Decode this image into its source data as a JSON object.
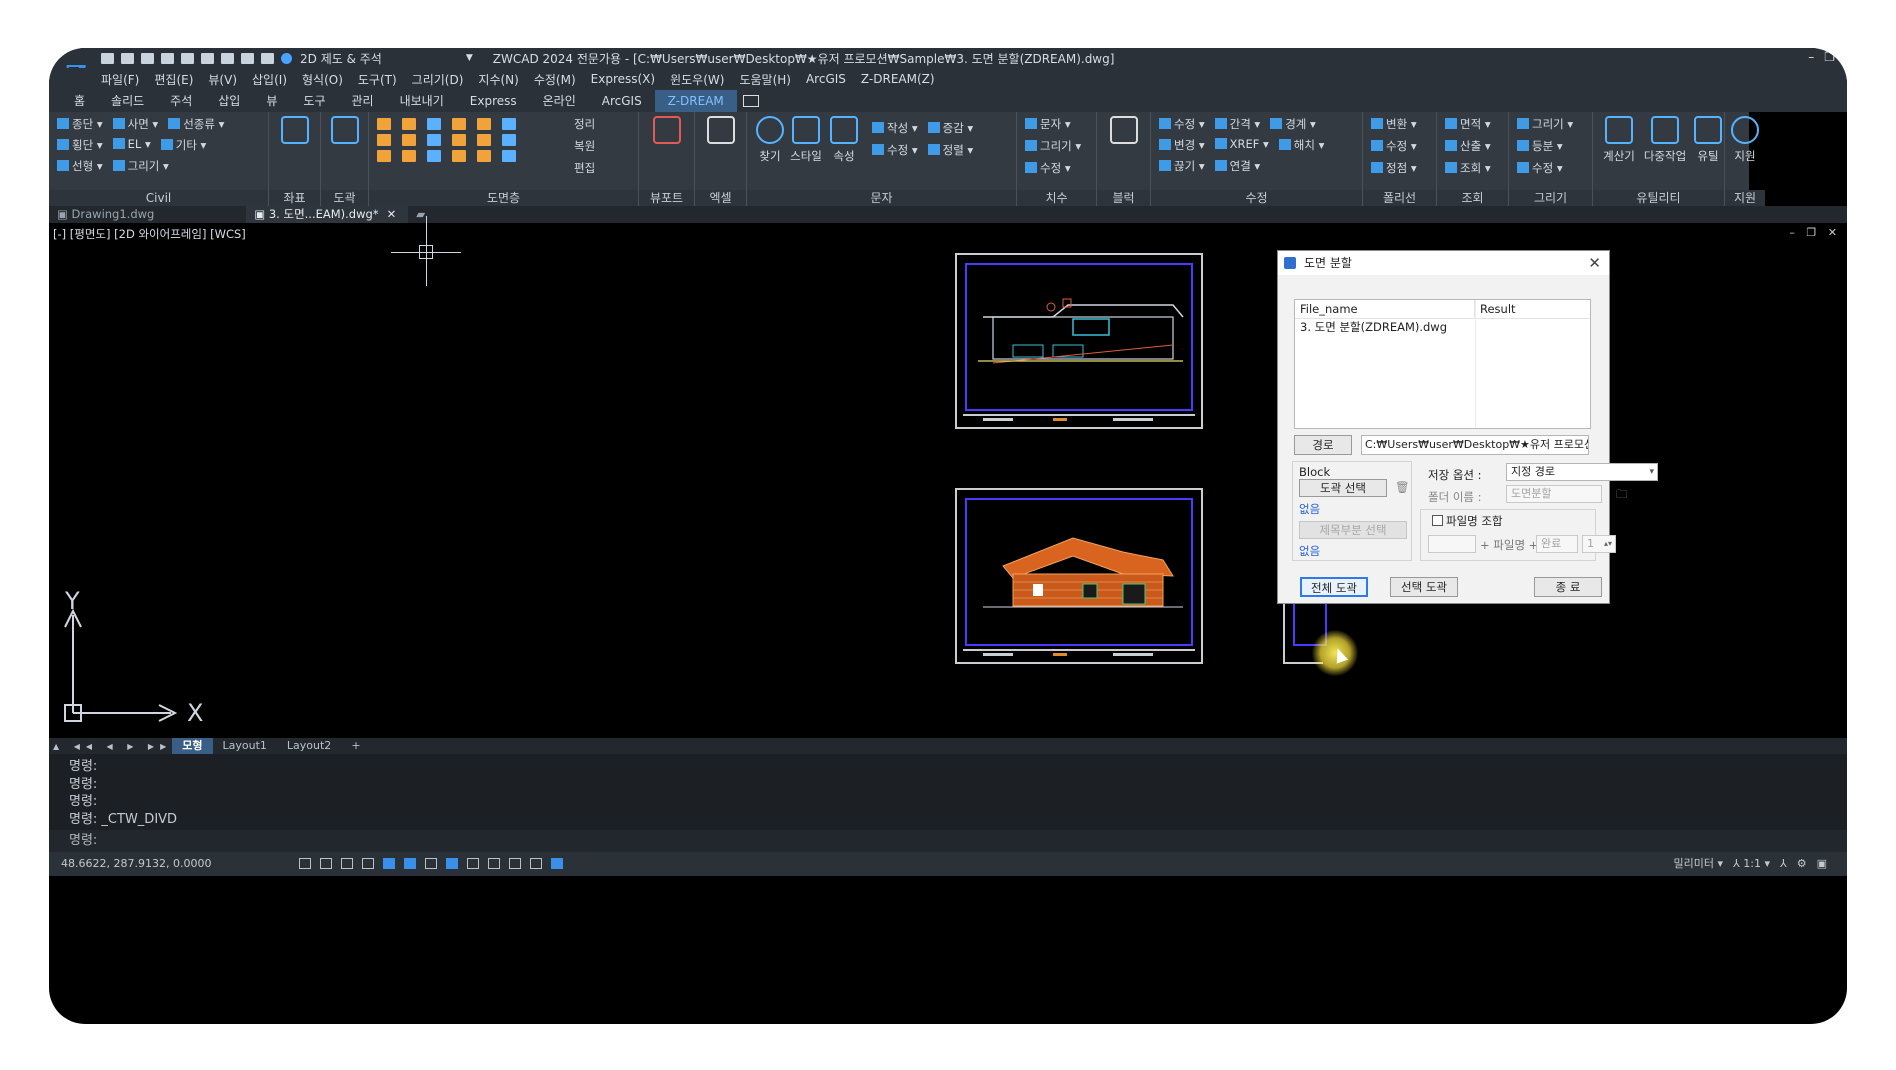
{
  "title_bar": {
    "workspace": "2D 제도 & 주석",
    "title": "ZWCAD 2024 전문가용 - [C:₩Users₩user₩Desktop₩★유저 프로모션₩Sample₩3. 도면 분할(ZDREAM).dwg]"
  },
  "menu": [
    "파일(F)",
    "편집(E)",
    "뷰(V)",
    "삽입(I)",
    "형식(O)",
    "도구(T)",
    "그리기(D)",
    "지수(N)",
    "수정(M)",
    "Express(X)",
    "윈도우(W)",
    "도움말(H)",
    "ArcGIS",
    "Z-DREAM(Z)"
  ],
  "ribbon_tabs": [
    "홈",
    "솔리드",
    "주석",
    "삽입",
    "뷰",
    "도구",
    "관리",
    "내보내기",
    "Express",
    "온라인",
    "ArcGIS",
    "Z-DREAM"
  ],
  "active_tab": "Z-DREAM",
  "ribbon": {
    "civil": {
      "caption": "Civil",
      "row1": [
        "종단",
        "사면",
        "선종류"
      ],
      "row2": [
        "횡단",
        "EL",
        "기타"
      ],
      "row3": [
        "선형",
        "그리기"
      ]
    },
    "coord": {
      "caption": "좌표"
    },
    "drawing": {
      "caption": "도곽"
    },
    "layers": {
      "caption": "도면층",
      "row1": "정리",
      "row2": "복원",
      "row3": "편집"
    },
    "viewport": {
      "caption": "뷰포트"
    },
    "excel": {
      "caption": "엑셀"
    },
    "text": {
      "caption": "문자",
      "find": "찾기",
      "style": "스타일",
      "prop": "속성",
      "row1": [
        "작성",
        "증감"
      ],
      "row2": [
        "수정",
        "정렬"
      ]
    },
    "dim": {
      "caption": "치수",
      "row1": "문자",
      "row2": "그리기",
      "row3": "수정"
    },
    "block": {
      "caption": "블럭"
    },
    "modify": {
      "caption": "수정",
      "row1": [
        "수정",
        "간격",
        "경계"
      ],
      "row2": [
        "변경",
        "XREF",
        "해치"
      ],
      "row3": [
        "끊기",
        "연결"
      ]
    },
    "polyline": {
      "caption": "폴리선",
      "row1": "변환",
      "row2": "수정",
      "row3": "정점"
    },
    "query": {
      "caption": "조회",
      "row1": "면적",
      "row2": "산출",
      "row3": "조회"
    },
    "drawing2": {
      "caption": "그리기",
      "row1": "그리기",
      "row2": "등분",
      "row3": "수정"
    },
    "utility": {
      "caption": "유틸리티",
      "calc": "계산기",
      "multi": "다중작업",
      "util": "유틸"
    },
    "support": {
      "caption": "지원",
      "label": "지원"
    }
  },
  "doc_tabs": [
    "Drawing1.dwg",
    "3. 도면...EAM).dwg*"
  ],
  "viewport_label": "[-] [평면도] [2D 와이어프레임] [WCS]",
  "ucs": {
    "y": "Y",
    "x": "X"
  },
  "layout_tabs": [
    "모형",
    "Layout1",
    "Layout2",
    "+"
  ],
  "command_history": [
    "명령:",
    "명령:",
    "명령:",
    "명령: _CTW_DIVD"
  ],
  "command_prompt": "명령:",
  "status": {
    "coords": "48.6622, 287.9132, 0.0000",
    "units": "밀리미터",
    "scale": "1:1"
  },
  "dialog": {
    "title": "도면 분할",
    "col_file": "File_name",
    "col_result": "Result",
    "rows": [
      {
        "file": "3. 도면 분할(ZDREAM).dwg",
        "result": ""
      }
    ],
    "path_button": "경로",
    "path_value": "C:₩Users₩user₩Desktop₩★유저 프로모션₩Sample₩",
    "block_label": "Block",
    "select_frame": "도곽 선택",
    "none1": "없음",
    "select_disabled": "제목부분 선택",
    "none2": "없음",
    "save_option_label": "저장 옵션 :",
    "save_option_value": "지정 경로",
    "folder_label": "폴더 이름 :",
    "folder_placeholder": "도면분할",
    "filename_combine": "파일명 조합",
    "plus_filename": "+ 파일명 +",
    "plus_suffix": "완료",
    "spin_value": "1",
    "btn_all": "전체 도곽",
    "btn_selected": "선택 도곽",
    "btn_close": "종 료"
  }
}
